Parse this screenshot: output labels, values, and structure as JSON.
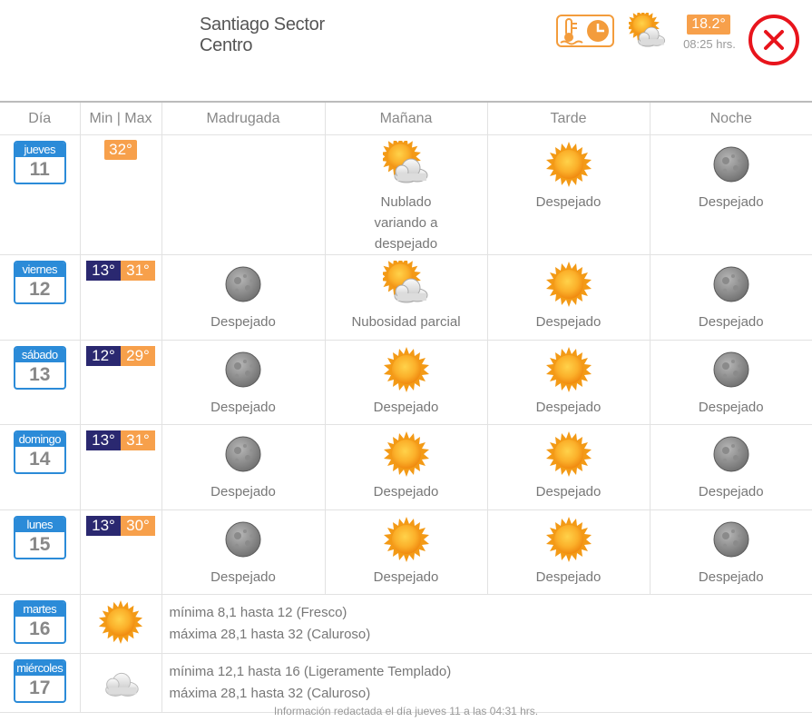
{
  "header": {
    "title": "Santiago Sector Centro",
    "current_temp": "18.2°",
    "current_time": "08:25 hrs.",
    "thermo_icon": "thermometer-clock-icon",
    "condition_icon": "partly-cloudy-icon",
    "close_icon": "close-icon"
  },
  "colors": {
    "accent": "#f7a04b",
    "min": "#2a2870",
    "calendar": "#2b8bd8",
    "close": "#e8141c"
  },
  "columns": [
    "Día",
    "Min | Max",
    "Madrugada",
    "Mañana",
    "Tarde",
    "Noche"
  ],
  "days": [
    {
      "name": "jueves",
      "num": "11",
      "min": "",
      "max": "32°",
      "periods": [
        {
          "icon": "",
          "label": ""
        },
        {
          "icon": "partly-cloudy",
          "label": "Nublado variando a despejado"
        },
        {
          "icon": "sun",
          "label": "Despejado"
        },
        {
          "icon": "moon",
          "label": "Despejado"
        }
      ]
    },
    {
      "name": "viernes",
      "num": "12",
      "min": "13°",
      "max": "31°",
      "periods": [
        {
          "icon": "moon",
          "label": "Despejado"
        },
        {
          "icon": "partly-cloudy",
          "label": "Nubosidad parcial"
        },
        {
          "icon": "sun",
          "label": "Despejado"
        },
        {
          "icon": "moon",
          "label": "Despejado"
        }
      ]
    },
    {
      "name": "sábado",
      "num": "13",
      "min": "12°",
      "max": "29°",
      "periods": [
        {
          "icon": "moon",
          "label": "Despejado"
        },
        {
          "icon": "sun",
          "label": "Despejado"
        },
        {
          "icon": "sun",
          "label": "Despejado"
        },
        {
          "icon": "moon",
          "label": "Despejado"
        }
      ]
    },
    {
      "name": "domingo",
      "num": "14",
      "min": "13°",
      "max": "31°",
      "periods": [
        {
          "icon": "moon",
          "label": "Despejado"
        },
        {
          "icon": "sun",
          "label": "Despejado"
        },
        {
          "icon": "sun",
          "label": "Despejado"
        },
        {
          "icon": "moon",
          "label": "Despejado"
        }
      ]
    },
    {
      "name": "lunes",
      "num": "15",
      "min": "13°",
      "max": "30°",
      "periods": [
        {
          "icon": "moon",
          "label": "Despejado"
        },
        {
          "icon": "sun",
          "label": "Despejado"
        },
        {
          "icon": "sun",
          "label": "Despejado"
        },
        {
          "icon": "moon",
          "label": "Despejado"
        }
      ]
    }
  ],
  "extended": [
    {
      "name": "martes",
      "num": "16",
      "icon": "sun",
      "line1": "mínima 8,1 hasta 12 (Fresco)",
      "line2": "máxima 28,1 hasta 32 (Caluroso)"
    },
    {
      "name": "miércoles",
      "num": "17",
      "icon": "cloud",
      "line1": "mínima 12,1 hasta 16 (Ligeramente Templado)",
      "line2": "máxima 28,1 hasta 32 (Caluroso)"
    }
  ],
  "footer": "Información redactada el día jueves 11 a las 04:31 hrs."
}
